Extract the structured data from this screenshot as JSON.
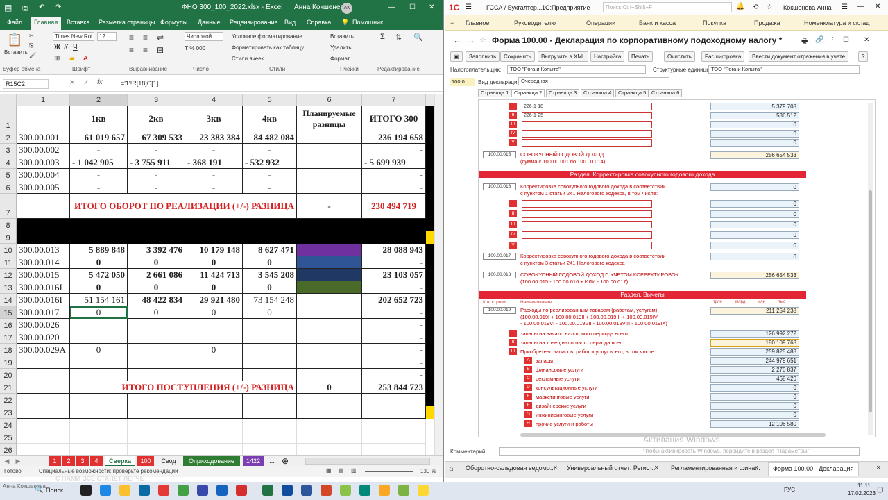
{
  "excel": {
    "title_file": "ФНО 300_100_2022.xlsx  -  Excel",
    "user": "Анна Кокшенева",
    "user_initials": "АК",
    "tabs": [
      "Файл",
      "Главная",
      "Вставка",
      "Разметка страницы",
      "Формулы",
      "Данные",
      "Рецензирование",
      "Вид",
      "Справка",
      "Помощник"
    ],
    "ribbon": {
      "paste": "Вставить",
      "font_name": "Times New Roi",
      "font_size": "12",
      "number_format": "Числовой",
      "cond_format": "Условное форматирование",
      "format_table": "Форматировать как таблицу",
      "cell_styles": "Стили ячеек",
      "insert": "Вставить",
      "delete": "Удалить",
      "format": "Формат",
      "groups": [
        "Буфер обмена",
        "Шрифт",
        "Выравнивание",
        "Число",
        "Стили",
        "Ячейки",
        "Редактирование"
      ]
    },
    "name_box": "R15C2",
    "formula": "='1'!R[18]C[1]",
    "col_headers": [
      "1",
      "2",
      "3",
      "4",
      "5",
      "6",
      "7"
    ],
    "headers_row": {
      "c2": "1кв",
      "c3": "2кв",
      "c4": "3кв",
      "c5": "4кв",
      "c6": "Планируемые разницы",
      "c7": "ИТОГО 300"
    },
    "rows": [
      {
        "n": "2",
        "c1": "300.00.001",
        "c2": "61 019 657",
        "c3": "67 309 533",
        "c4": "23 383 384",
        "c5": "84 482 084",
        "c6": "",
        "c7": "236 194 658"
      },
      {
        "n": "3",
        "c1": "300.00.002",
        "c2": "-",
        "c3": "-",
        "c4": "-",
        "c5": "-",
        "c6": "",
        "c7": "-"
      },
      {
        "n": "4",
        "c1": "300.00.003",
        "c2": "- 1 042 905",
        "c3": "- 3 755 911",
        "c4": "- 368 191",
        "c5": "- 532 932",
        "c6": "",
        "c7": "- 5 699 939"
      },
      {
        "n": "5",
        "c1": "300.00.004",
        "c2": "-",
        "c3": "-",
        "c4": "-",
        "c5": "-",
        "c6": "",
        "c7": "-"
      },
      {
        "n": "6",
        "c1": "300.00.005",
        "c2": "-",
        "c3": "-",
        "c4": "-",
        "c5": "-",
        "c6": "",
        "c7": "-"
      }
    ],
    "row7": {
      "n": "7",
      "label": "ИТОГО ОБОРОТ ПО РЕАЛИЗАЦИИ (+/-) РАЗНИЦА",
      "c6": "-",
      "c7": "230 494 719"
    },
    "rows2": [
      {
        "n": "10",
        "c1": "300.00.013",
        "c2": "5 889 848",
        "c3": "3 392 476",
        "c4": "10 179 148",
        "c5": "8 627 471",
        "c6": "",
        "c7": "28 088 943"
      },
      {
        "n": "11",
        "c1": "300.00.014",
        "c2": "0",
        "c3": "0",
        "c4": "0",
        "c5": "0",
        "c6": "",
        "c7": "-"
      },
      {
        "n": "12",
        "c1": "300.00.015",
        "c2": "5 472 050",
        "c3": "2 661 086",
        "c4": "11 424 713",
        "c5": "3 545 208",
        "c6": "",
        "c7": "23 103 057"
      },
      {
        "n": "13",
        "c1": "300.00.016I",
        "c2": "0",
        "c3": "0",
        "c4": "0",
        "c5": "0",
        "c6": "",
        "c7": "-"
      },
      {
        "n": "14",
        "c1": "300.00.016I",
        "c2": "51 154 161",
        "c3": "48 422 834",
        "c4": "29 921 480",
        "c5": "73 154 248",
        "c6": "",
        "c7": "202 652 723"
      },
      {
        "n": "15",
        "c1": "300.00.017",
        "c2": "0",
        "c3": "0",
        "c4": "0",
        "c5": "0",
        "c6": "",
        "c7": "-"
      },
      {
        "n": "16",
        "c1": "300.00.026",
        "c2": "",
        "c3": "",
        "c4": "",
        "c5": "",
        "c6": "",
        "c7": "-"
      },
      {
        "n": "17",
        "c1": "300.00.020",
        "c2": "",
        "c3": "",
        "c4": "",
        "c5": "",
        "c6": "",
        "c7": "-"
      },
      {
        "n": "18",
        "c1": "300.00.029A",
        "c2": "0",
        "c3": "",
        "c4": "0",
        "c5": "",
        "c6": "",
        "c7": "-"
      },
      {
        "n": "19",
        "c1": "",
        "c2": "",
        "c3": "",
        "c4": "",
        "c5": "",
        "c6": "",
        "c7": "-"
      },
      {
        "n": "20",
        "c1": "",
        "c2": "",
        "c3": "",
        "c4": "",
        "c5": "",
        "c6": "",
        "c7": "-"
      }
    ],
    "row21": {
      "n": "21",
      "label": "ИТОГО ПОСТУПЛЕНИЯ (+/-) РАЗНИЦА",
      "c6": "0",
      "c7": "253 844 723"
    },
    "row_nums_black": [
      "8",
      "9"
    ],
    "row_nums_tail": [
      "22",
      "23",
      "24",
      "25",
      "26"
    ],
    "sheets": [
      "1",
      "2",
      "3",
      "4",
      "Сверка",
      "100",
      "Свод",
      "Оприходование",
      "1422",
      "..."
    ],
    "status_ready": "Готово",
    "status_access": "Специальные возможности: проверьте рекомендации",
    "zoom": "130 %"
  },
  "onec": {
    "app_title": "ГССА / Бухгалтер...",
    "app_name": "1С:Предприятие",
    "search_placeholder": "Поиск Ctrl+Shift+F",
    "user": "Кокшенева Анна",
    "nav": [
      "Главное",
      "Руководителю",
      "Операции",
      "Банк и касса",
      "Покупка",
      "Продажа",
      "Номенклатура и склад"
    ],
    "form_title": "Форма 100.00 - Декларация по корпоративному подоходному налогу *",
    "toolbar": [
      "Заполнить",
      "Сохранить",
      "Выгрузить в XML",
      "Настройка",
      "Печать",
      "Очистить",
      "Расшифровка",
      "Ввести документ отражения в учете"
    ],
    "taxpayer_label": "Налогоплательщик:",
    "taxpayer": "ТОО \"Рога и Копыта\"",
    "struct_label": "Структурные единицы:",
    "struct": "ТОО \"Рога и Копыта\"",
    "decl_type_label": "Вид декларации:",
    "decl_type": "Очередная",
    "left_code": "100.0",
    "pages": [
      "Страница 1",
      "Страница 2",
      "Страница 3",
      "Страница 4",
      "Страница 5",
      "Страница 6"
    ],
    "top_rows": [
      {
        "badge": "I",
        "text": "226-1-18",
        "val": "5 379 708"
      },
      {
        "badge": "II",
        "text": "226-1-25",
        "val": "536 512"
      },
      {
        "badge": "III",
        "text": "",
        "val": "0"
      },
      {
        "badge": "IV",
        "text": "",
        "val": "0"
      },
      {
        "badge": "V",
        "text": "",
        "val": "0"
      }
    ],
    "r015": {
      "code": "100.00.015",
      "l1": "СОВОКУПНЫЙ ГОДОВОЙ ДОХОД",
      "l2": "(сумма с 100.00.001 по 100.00.014)",
      "val": "256 654 533"
    },
    "sec1": "Раздел. Корректировка совокупного годового дохода",
    "r016": {
      "code": "100.00.016",
      "l1": "Корректировка совокупного годового дохода в соответствии",
      "l2": "с пунктом 1 статьи 241 Налогового кодекса, в том числе:",
      "val": "0"
    },
    "r016_rows": [
      {
        "badge": "I",
        "val": "0"
      },
      {
        "badge": "II",
        "val": "0"
      },
      {
        "badge": "III",
        "val": "0"
      },
      {
        "badge": "IV",
        "val": "0"
      },
      {
        "badge": "V",
        "val": "0"
      }
    ],
    "r017": {
      "code": "100.00.017",
      "l1": "Корректировка совокупного годового дохода в соответствии",
      "l2": "с пунктом 3 статьи 241 Налогового кодекса",
      "val": "0"
    },
    "r018": {
      "code": "100.00.018",
      "l1": "СОВОКУПНЫЙ ГОДОВОЙ ДОХОД С УЧЕТОМ КОРРЕКТИРОВОК",
      "l2": "(100.00.015 - 100.00.016 + ИЛИ - 100.00.017)",
      "val": "256 654 533"
    },
    "sec2": "Раздел. Вычеты",
    "colhdr": {
      "code": "Код строки",
      "name": "Наименование",
      "u1": "трлн",
      "u2": "млрд",
      "u3": "млн",
      "u4": "тыс"
    },
    "r019": {
      "code": "100.00.019",
      "l1": "Расходы по реализованным товарам (работам, услугам)",
      "l2": "(100.00.019I + 100.00.019II + 100.00.019III + 100.00.019IV",
      "l3": "- 100.00.019VI - 100.00.019VII - 100.00.019VIII - 100.00.019IX)",
      "val": "211 254 238"
    },
    "r019_rows": [
      {
        "badge": "I",
        "text": "запасы на начало налогового периода всего",
        "val": "126 992 272"
      },
      {
        "badge": "II",
        "text": "запасы на конец налогового периода всего",
        "val": "180 109 768"
      },
      {
        "badge": "III",
        "text": "Приобретено запасов, работ и услуг всего, в том числе:",
        "val": "259 825 488"
      }
    ],
    "sub_rows": [
      {
        "badge": "A",
        "text": "запасы",
        "val": "244 979 651"
      },
      {
        "badge": "B",
        "text": "финансовые услуги",
        "val": "2 270 837"
      },
      {
        "badge": "C",
        "text": "рекламные услуги",
        "val": "468 420"
      },
      {
        "badge": "D",
        "text": "консультационные услуги",
        "val": "0"
      },
      {
        "badge": "E",
        "text": "маркетинговые услуги",
        "val": "0"
      },
      {
        "badge": "F",
        "text": "дизайнерские услуги",
        "val": "0"
      },
      {
        "badge": "G",
        "text": "инжиниринговые услуги",
        "val": "0"
      },
      {
        "badge": "H",
        "text": "прочие услуги и работы",
        "val": "12 106 580"
      }
    ],
    "comment_label": "Комментарий:",
    "watermark1": "Активация Windows",
    "watermark2": "Чтобы активировать Windows, перейдите в раздел \"Параметры\".",
    "bottom_tabs": [
      "Оборотно-сальдовая ведомо...",
      "Универсальный отчет: Регист...",
      "Регламентированная и фина...",
      "Форма 100.00 - Декларация"
    ]
  },
  "taskbar": {
    "search": "Поиск",
    "lang": "РУС",
    "time": "11:11",
    "date": "17.02.2023",
    "user_tag": "Анна Кокшенева",
    "watermark": "С НАМИ ВСЁ СТАНЕТ ЛЕГЧЕ"
  }
}
